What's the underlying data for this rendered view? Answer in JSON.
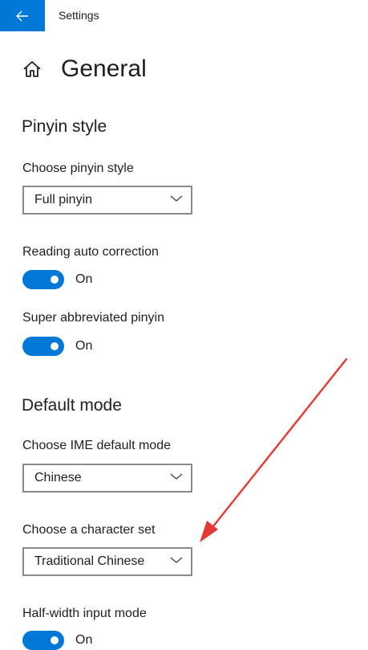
{
  "window": {
    "title": "Settings"
  },
  "page": {
    "title": "General"
  },
  "sections": {
    "pinyin": {
      "title": "Pinyin style",
      "choose_label": "Choose pinyin style",
      "choose_value": "Full pinyin",
      "reading_label": "Reading auto correction",
      "reading_state": "On",
      "super_label": "Super abbreviated pinyin",
      "super_state": "On"
    },
    "default_mode": {
      "title": "Default mode",
      "ime_label": "Choose IME default mode",
      "ime_value": "Chinese",
      "charset_label": "Choose a character set",
      "charset_value": "Traditional Chinese",
      "halfwidth_label": "Half-width input mode",
      "halfwidth_state": "On"
    }
  },
  "colors": {
    "accent": "#0078d7",
    "annotation": "#e53935"
  },
  "icons": {
    "back": "back-arrow-icon",
    "home": "home-icon",
    "dropdown": "chevron-down-icon"
  }
}
